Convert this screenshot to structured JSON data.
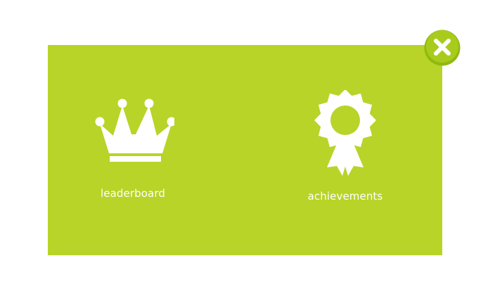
{
  "colors": {
    "panel_background": "#b8d428",
    "page_background": "#ffffff",
    "icon_color": "#ffffff",
    "close_button_outer": "#8fba10",
    "close_button_inner": "#a9cc1c"
  },
  "menu": {
    "items": [
      {
        "id": "leaderboard",
        "label": "leaderboard",
        "icon": "crown-icon"
      },
      {
        "id": "achievements",
        "label": "achievements",
        "icon": "award-ribbon-icon"
      }
    ]
  },
  "close_button": {
    "icon": "close-icon"
  }
}
